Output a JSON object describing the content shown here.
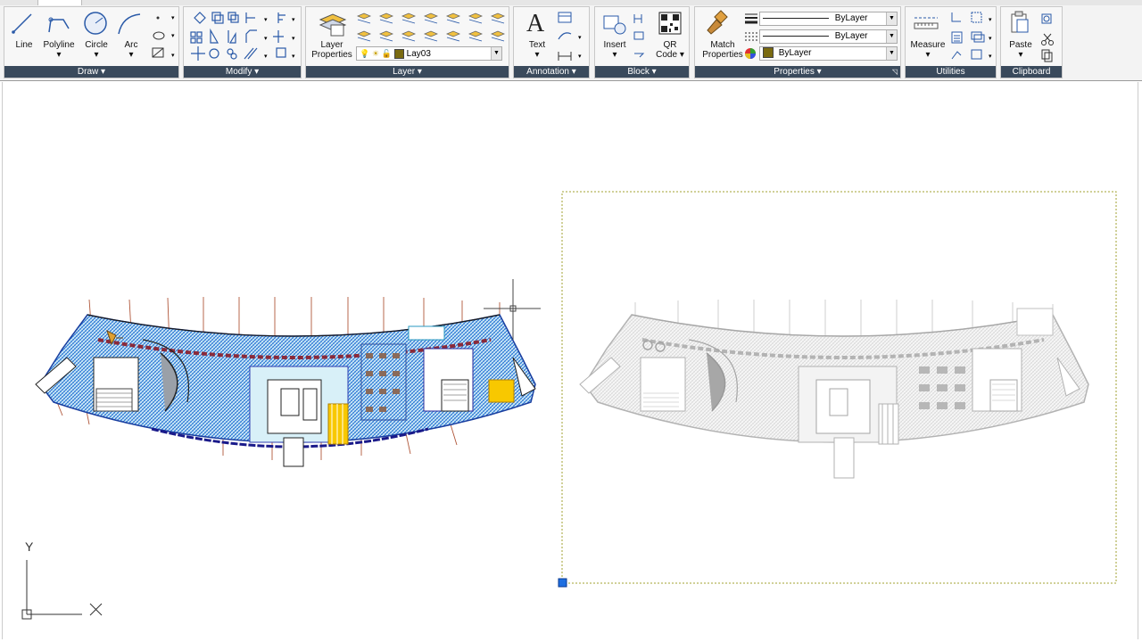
{
  "ribbon": {
    "draw": {
      "title": "Draw",
      "line": "Line",
      "polyline": "Polyline",
      "circle": "Circle",
      "arc": "Arc"
    },
    "modify": {
      "title": "Modify"
    },
    "layer": {
      "title": "Layer",
      "layer_properties_1": "Layer",
      "layer_properties_2": "Properties",
      "current_layer": "Lay03"
    },
    "annotation": {
      "title": "Annotation",
      "text": "Text"
    },
    "block": {
      "title": "Block",
      "insert": "Insert",
      "qr_1": "QR",
      "qr_2": "Code"
    },
    "properties": {
      "title": "Properties",
      "match_1": "Match",
      "match_2": "Properties",
      "linetype": "ByLayer",
      "lineweight": "ByLayer",
      "color": "ByLayer"
    },
    "utilities": {
      "title": "Utilities",
      "measure": "Measure"
    },
    "clipboard": {
      "title": "Clipboard",
      "paste": "Paste"
    }
  },
  "ucs": {
    "y_label": "Y",
    "x_label": "X"
  },
  "colors": {
    "panel_title": "#3a4a5c",
    "accent": "#1a5fd0",
    "selection_grip": "#1f6fe0"
  }
}
